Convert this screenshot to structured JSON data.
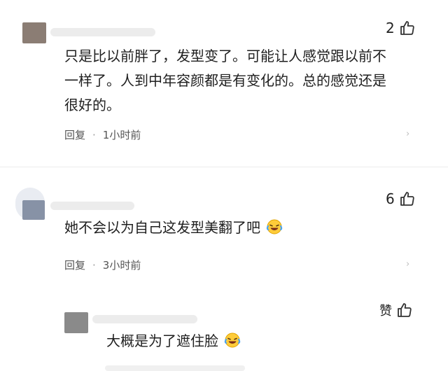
{
  "comments": [
    {
      "likes": "2",
      "text_lines": [
        "只是比以前胖了，发型变了。可能让人感觉跟以前不",
        "一样了。人到中年容颜都是有变化的。总的感觉还是",
        "很好的。"
      ],
      "reply_label": "回复",
      "separator": "·",
      "time": "1小时前"
    },
    {
      "likes": "6",
      "text": "她不会以为自己这发型美翻了吧",
      "emoji": "laughing-tears",
      "reply_label": "回复",
      "separator": "·",
      "time": "3小时前"
    },
    {
      "likes": "赞",
      "text": "大概是为了遮住脸",
      "emoji": "laughing-tears"
    }
  ],
  "colors": {
    "text": "#1f1f1f",
    "meta": "#555555",
    "divider": "#ececec",
    "avatar": "#8d8d8d"
  }
}
